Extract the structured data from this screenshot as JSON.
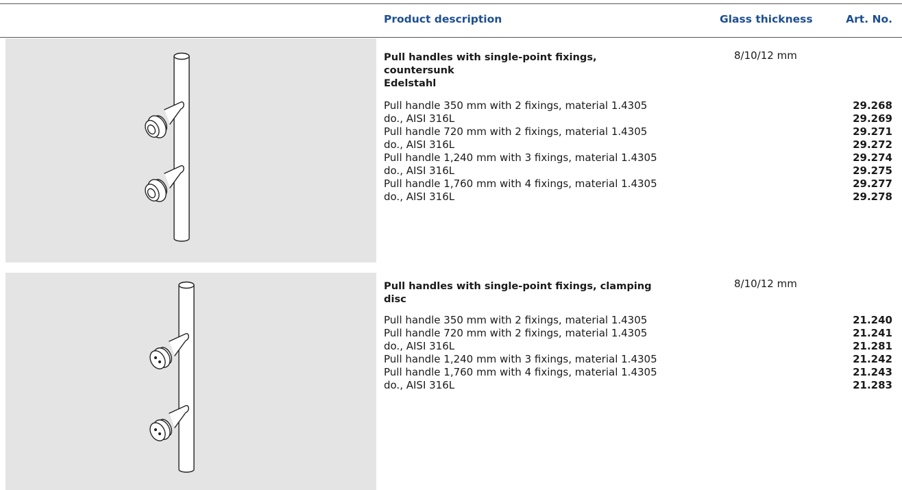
{
  "header": {
    "desc": "Product description",
    "glass": "Glass thickness",
    "art": "Art. No."
  },
  "products": [
    {
      "image_icon": "pull-handle-countersunk-icon",
      "title1": "Pull handles with single-point fixings,",
      "title2": "countersunk",
      "title3": "Edelstahl",
      "glass": "8/10/12 mm",
      "lines": [
        "Pull handle 350 mm with 2 fixings, material 1.4305",
        "do., AISI 316L",
        "Pull handle 720 mm with 2 fixings, material 1.4305",
        "do., AISI 316L",
        "Pull handle 1,240 mm with 3 fixings, material 1.4305",
        "do., AISI 316L",
        "Pull handle 1,760 mm with 4 fixings, material 1.4305",
        "do., AISI 316L"
      ],
      "arts": [
        "29.268",
        "29.269",
        "29.271",
        "29.272",
        "29.274",
        "29.275",
        "29.277",
        "29.278"
      ]
    },
    {
      "image_icon": "pull-handle-clamping-disc-icon",
      "title1": "Pull handles with single-point fixings, clamping",
      "title2": "disc",
      "glass": "8/10/12 mm",
      "lines": [
        "Pull handle 350 mm with 2 fixings, material 1.4305",
        "Pull handle 720 mm with 2 fixings, material 1.4305",
        "do., AISI 316L",
        "Pull handle 1,240 mm with 3 fixings, material 1.4305",
        "Pull handle 1,760 mm with 4 fixings, material 1.4305",
        "do., AISI 316L"
      ],
      "arts": [
        "21.240",
        "21.241",
        "21.281",
        "21.242",
        "21.243",
        "21.283"
      ]
    }
  ]
}
